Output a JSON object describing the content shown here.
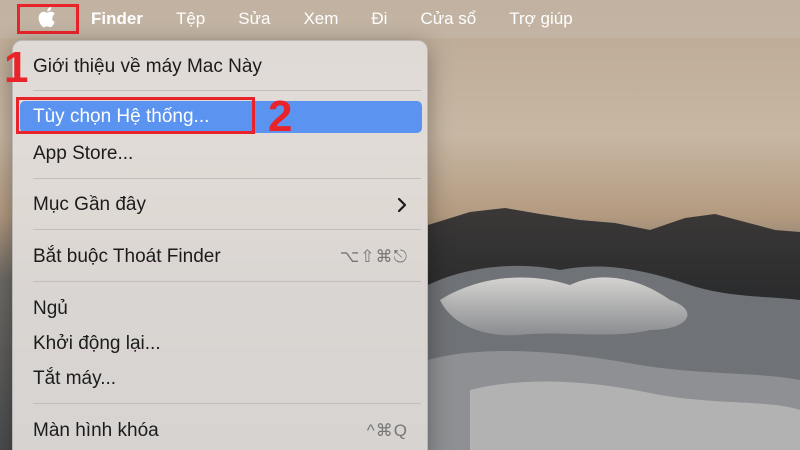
{
  "menubar": {
    "app_name": "Finder",
    "items": [
      "Tệp",
      "Sửa",
      "Xem",
      "Đi",
      "Cửa sổ",
      "Trợ giúp"
    ],
    "apple_icon": "apple-logo-icon"
  },
  "menu": {
    "items": [
      {
        "label": "Giới thiệu về máy Mac Này"
      },
      {
        "label": "Tùy chọn Hệ thống..."
      },
      {
        "label": "App Store..."
      },
      {
        "label": "Mục Gần đây"
      },
      {
        "label": "Bắt buộc Thoát Finder",
        "shortcut": "⌥⇧⌘⎋"
      },
      {
        "label": "Ngủ"
      },
      {
        "label": "Khởi động lại..."
      },
      {
        "label": "Tắt máy..."
      },
      {
        "label": "Màn hình khóa",
        "shortcut": "^⌘Q"
      }
    ],
    "highlight_color": "#5a93f0"
  },
  "annotations": {
    "step1": "1",
    "step2": "2",
    "color": "#e8242a"
  }
}
